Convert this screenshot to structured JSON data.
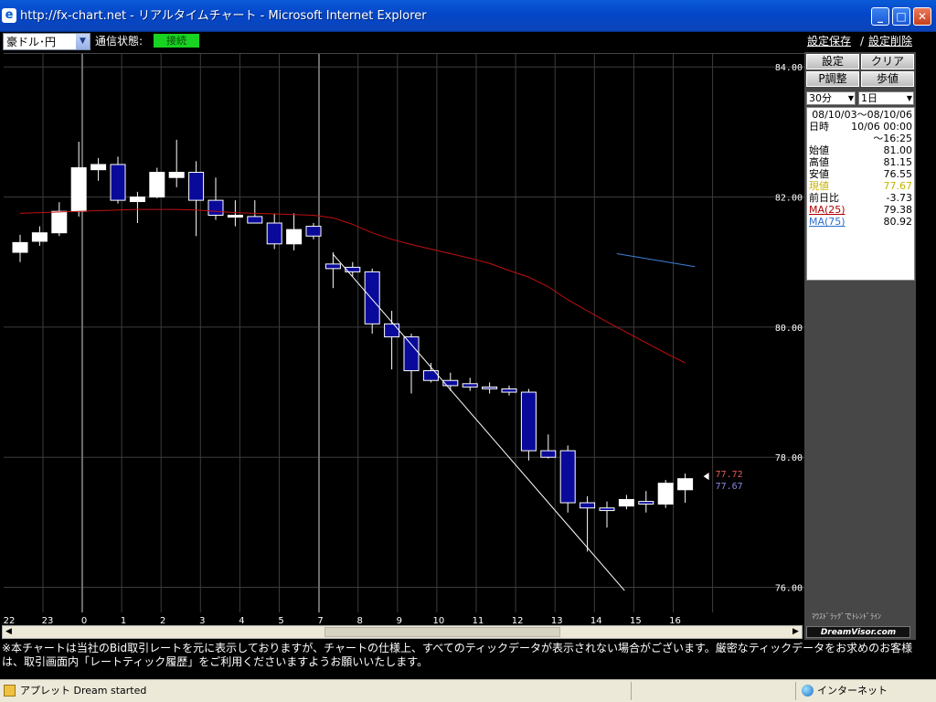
{
  "window": {
    "title": "http://fx-chart.net - リアルタイムチャート - Microsoft Internet Explorer",
    "minimize": "_",
    "maximize": "□",
    "close": "✕"
  },
  "toolbar": {
    "currency_pair": "豪ドル･円",
    "status_label": "通信状態:",
    "status_value": "接続",
    "save_settings": "設定保存",
    "separator": "/",
    "delete_settings": "設定削除"
  },
  "side_panel": {
    "buttons": [
      "設定",
      "クリア",
      "P調整",
      "歩値"
    ],
    "interval": "30分",
    "span": "1日",
    "date_range": "08/10/03～08/10/06",
    "rows": [
      {
        "label": "日時",
        "value": "10/06 00:00"
      },
      {
        "label": "",
        "value": "～16:25"
      },
      {
        "label": "始値",
        "value": "81.00"
      },
      {
        "label": "高値",
        "value": "81.15"
      },
      {
        "label": "安値",
        "value": "76.55"
      },
      {
        "label": "現値",
        "value": "77.67"
      },
      {
        "label": "前日比",
        "value": "-3.73"
      },
      {
        "label": "MA(25)",
        "value": "79.38"
      },
      {
        "label": "MA(75)",
        "value": "80.92"
      }
    ],
    "drag_hint": "ﾏｳｽﾄﾞﾗｯｸﾞでﾄﾚﾝﾄﾞﾗｲﾝ",
    "brand": "DreamVisor.com",
    "colors": {
      "current_value": "#c8b400",
      "ma25": "#b00000",
      "ma75": "#2a6fd0"
    }
  },
  "notice": "※本チャートは当社のBid取引レートを元に表示しておりますが、チャートの仕様上、すべてのティックデータが表示されない場合がございます。厳密なティックデータをお求めのお客様は、取引画面内「レートティック履歴」をご利用くださいますようお願いいたします。",
  "statusbar": {
    "applet": "アプレット Dream started",
    "zone": "インターネット"
  },
  "chart_data": {
    "type": "candlestick",
    "y_ticks": [
      "84.00",
      "82.00",
      "80.00",
      "78.00",
      "76.00"
    ],
    "ylim": [
      75.6,
      84.2
    ],
    "x_labels": [
      "22",
      "23",
      "0",
      "1",
      "2",
      "3",
      "4",
      "5",
      "7",
      "8",
      "9",
      "10",
      "11",
      "12",
      "13",
      "14",
      "15",
      "16"
    ],
    "price_labels": {
      "ask": "77.72",
      "bid": "77.67"
    },
    "colors": {
      "up": "#ffffff",
      "down": "#0a0a9a",
      "ma25": "#c01010",
      "ma75": "#3a82d6",
      "trendline": "#ffffff",
      "grid": "#3c3c3c",
      "ask_label": "#e05a5a",
      "bid_label": "#8a8ae6"
    },
    "candles": [
      {
        "o": 81.15,
        "h": 81.42,
        "l": 81.0,
        "c": 81.3
      },
      {
        "o": 81.32,
        "h": 81.55,
        "l": 81.25,
        "c": 81.45
      },
      {
        "o": 81.45,
        "h": 81.92,
        "l": 81.4,
        "c": 81.78
      },
      {
        "o": 81.78,
        "h": 82.85,
        "l": 81.7,
        "c": 82.45
      },
      {
        "o": 82.42,
        "h": 82.6,
        "l": 82.25,
        "c": 82.5
      },
      {
        "o": 82.5,
        "h": 82.62,
        "l": 81.9,
        "c": 81.95
      },
      {
        "o": 81.93,
        "h": 82.08,
        "l": 81.6,
        "c": 82.0
      },
      {
        "o": 82.0,
        "h": 82.45,
        "l": 81.98,
        "c": 82.38
      },
      {
        "o": 82.3,
        "h": 82.88,
        "l": 82.15,
        "c": 82.38
      },
      {
        "o": 82.38,
        "h": 82.55,
        "l": 81.4,
        "c": 81.95
      },
      {
        "o": 81.95,
        "h": 82.3,
        "l": 81.65,
        "c": 81.72
      },
      {
        "o": 81.72,
        "h": 81.95,
        "l": 81.55,
        "c": 81.72
      },
      {
        "o": 81.7,
        "h": 81.95,
        "l": 81.62,
        "c": 81.6
      },
      {
        "o": 81.6,
        "h": 81.75,
        "l": 81.2,
        "c": 81.28
      },
      {
        "o": 81.28,
        "h": 81.75,
        "l": 81.18,
        "c": 81.5
      },
      {
        "o": 81.55,
        "h": 81.6,
        "l": 81.35,
        "c": 81.4
      },
      {
        "o": 80.97,
        "h": 81.15,
        "l": 80.6,
        "c": 80.9
      },
      {
        "o": 80.92,
        "h": 81.0,
        "l": 80.78,
        "c": 80.85
      },
      {
        "o": 80.85,
        "h": 80.9,
        "l": 79.9,
        "c": 80.05
      },
      {
        "o": 80.05,
        "h": 80.25,
        "l": 79.35,
        "c": 79.85
      },
      {
        "o": 79.85,
        "h": 79.9,
        "l": 78.98,
        "c": 79.33
      },
      {
        "o": 79.33,
        "h": 79.45,
        "l": 79.15,
        "c": 79.18
      },
      {
        "o": 79.18,
        "h": 79.3,
        "l": 79.02,
        "c": 79.1
      },
      {
        "o": 79.13,
        "h": 79.22,
        "l": 79.02,
        "c": 79.08
      },
      {
        "o": 79.08,
        "h": 79.15,
        "l": 78.98,
        "c": 79.06
      },
      {
        "o": 79.05,
        "h": 79.1,
        "l": 78.95,
        "c": 79.0
      },
      {
        "o": 79.0,
        "h": 79.05,
        "l": 77.95,
        "c": 78.1
      },
      {
        "o": 78.1,
        "h": 78.35,
        "l": 77.98,
        "c": 78.0
      },
      {
        "o": 78.1,
        "h": 78.18,
        "l": 77.15,
        "c": 77.3
      },
      {
        "o": 77.3,
        "h": 77.4,
        "l": 76.55,
        "c": 77.22
      },
      {
        "o": 77.22,
        "h": 77.32,
        "l": 76.92,
        "c": 77.18
      },
      {
        "o": 77.25,
        "h": 77.42,
        "l": 77.2,
        "c": 77.35
      },
      {
        "o": 77.32,
        "h": 77.48,
        "l": 77.15,
        "c": 77.28
      },
      {
        "o": 77.28,
        "h": 77.65,
        "l": 77.22,
        "c": 77.6
      },
      {
        "o": 77.5,
        "h": 77.75,
        "l": 77.3,
        "c": 77.67
      }
    ],
    "ma25": [
      81.75,
      81.76,
      81.77,
      81.78,
      81.79,
      81.8,
      81.81,
      81.81,
      81.81,
      81.8,
      81.78,
      81.76,
      81.75,
      81.74,
      81.73,
      81.72,
      81.68,
      81.58,
      81.45,
      81.35,
      81.27,
      81.2,
      81.13,
      81.06,
      80.98,
      80.87,
      80.77,
      80.62,
      80.42,
      80.25,
      80.08,
      79.92,
      79.76,
      79.6,
      79.45
    ],
    "ma75_points": [
      [
        30.5,
        81.13
      ],
      [
        34.5,
        80.93
      ]
    ],
    "trendline": [
      [
        16.0,
        81.12
      ],
      [
        30.9,
        75.95
      ]
    ]
  }
}
